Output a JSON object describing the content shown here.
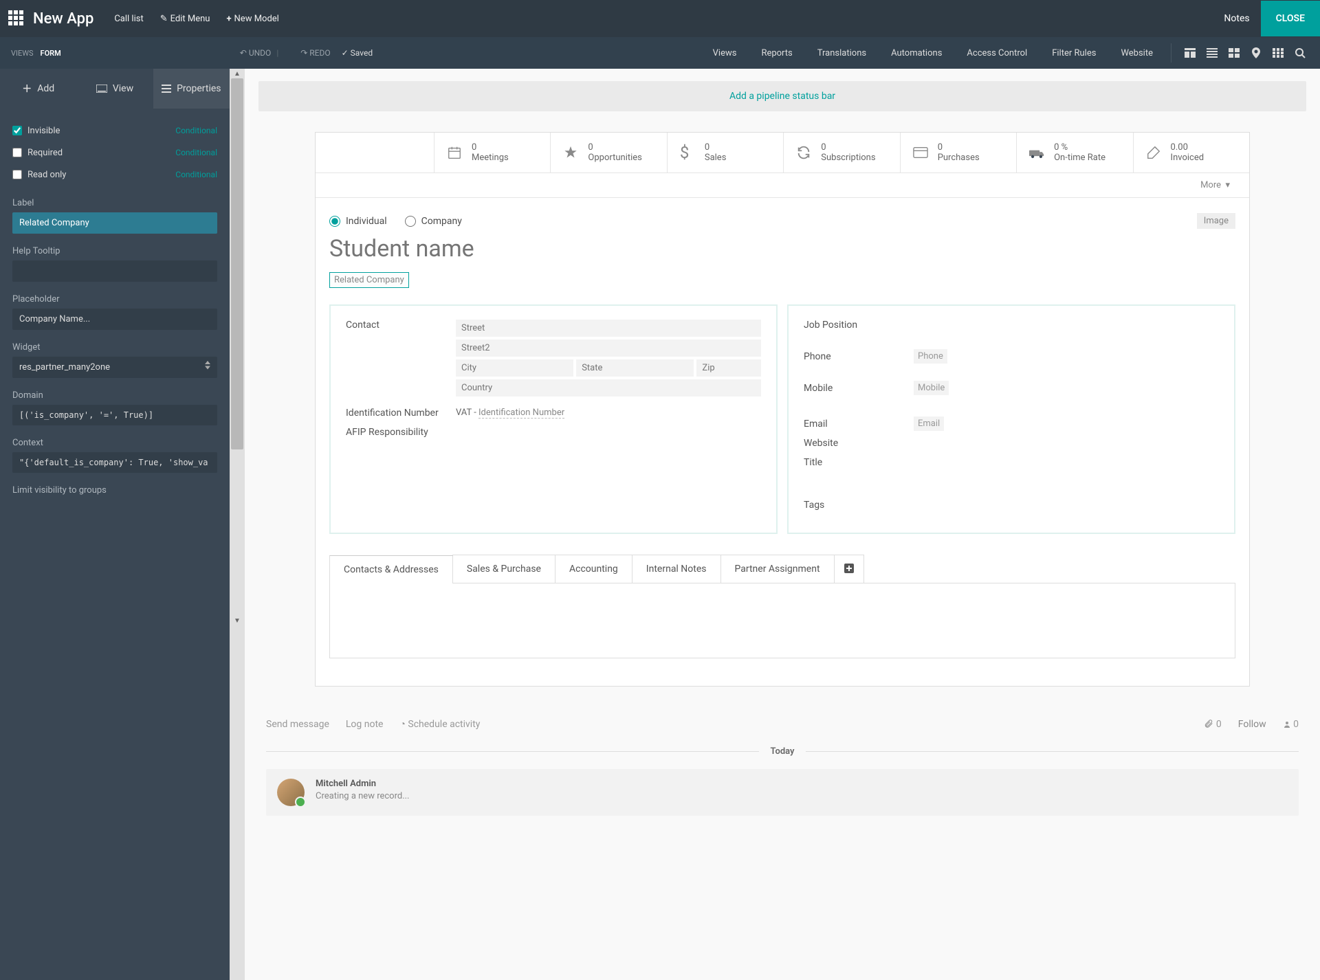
{
  "topbar": {
    "app_name": "New App",
    "call_list": "Call list",
    "edit_menu": "Edit Menu",
    "new_model": "New Model",
    "notes": "Notes",
    "close": "CLOSE"
  },
  "secbar": {
    "views": "VIEWS",
    "form": "FORM",
    "undo": "UNDO",
    "redo": "REDO",
    "saved": "Saved",
    "views_link": "Views",
    "reports": "Reports",
    "translations": "Translations",
    "automations": "Automations",
    "access_control": "Access Control",
    "filter_rules": "Filter Rules",
    "website": "Website"
  },
  "sidebar": {
    "tabs": {
      "add": "Add",
      "view": "View",
      "properties": "Properties"
    },
    "props": {
      "invisible": "Invisible",
      "required": "Required",
      "readonly": "Read only",
      "conditional": "Conditional",
      "label_lbl": "Label",
      "label_val": "Related Company",
      "help_lbl": "Help Tooltip",
      "placeholder_lbl": "Placeholder",
      "placeholder_val": "Company Name...",
      "widget_lbl": "Widget",
      "widget_val": "res_partner_many2one",
      "domain_lbl": "Domain",
      "domain_val": "[('is_company', '=', True)]",
      "context_lbl": "Context",
      "context_val": "\"{'default_is_company': True, 'show_va",
      "limit_lbl": "Limit visibility to groups"
    }
  },
  "form": {
    "pipeline": "Add a pipeline status bar",
    "stats": {
      "meetings": {
        "n": "0",
        "l": "Meetings"
      },
      "opportunities": {
        "n": "0",
        "l": "Opportunities"
      },
      "sales": {
        "n": "0",
        "l": "Sales"
      },
      "subscriptions": {
        "n": "0",
        "l": "Subscriptions"
      },
      "purchases": {
        "n": "0",
        "l": "Purchases"
      },
      "ontime": {
        "n": "0 %",
        "l": "On-time Rate"
      },
      "invoiced": {
        "n": "0.00",
        "l": "Invoiced"
      }
    },
    "more": "More",
    "individual": "Individual",
    "company": "Company",
    "image": "Image",
    "name_ph": "Student name",
    "related_company": "Related Company",
    "contact": "Contact",
    "street": "Street",
    "street2": "Street2",
    "city": "City",
    "state": "State",
    "zip": "Zip",
    "country": "Country",
    "idnum": "Identification Number",
    "vat": "VAT",
    "vat_hl": "Identification Number",
    "afip": "AFIP Responsibility",
    "job": "Job Position",
    "phone": "Phone",
    "phone_ph": "Phone",
    "mobile": "Mobile",
    "mobile_ph": "Mobile",
    "email": "Email",
    "email_ph": "Email",
    "website": "Website",
    "title": "Title",
    "tags": "Tags",
    "tabs": {
      "contacts": "Contacts & Addresses",
      "sales": "Sales & Purchase",
      "accounting": "Accounting",
      "internal": "Internal Notes",
      "partner": "Partner Assignment"
    }
  },
  "chatter": {
    "send": "Send message",
    "logn": "Log note",
    "sched": "Schedule activity",
    "attach": "0",
    "follow": "Follow",
    "followers": "0",
    "today": "Today",
    "author": "Mitchell Admin",
    "text": "Creating a new record..."
  }
}
